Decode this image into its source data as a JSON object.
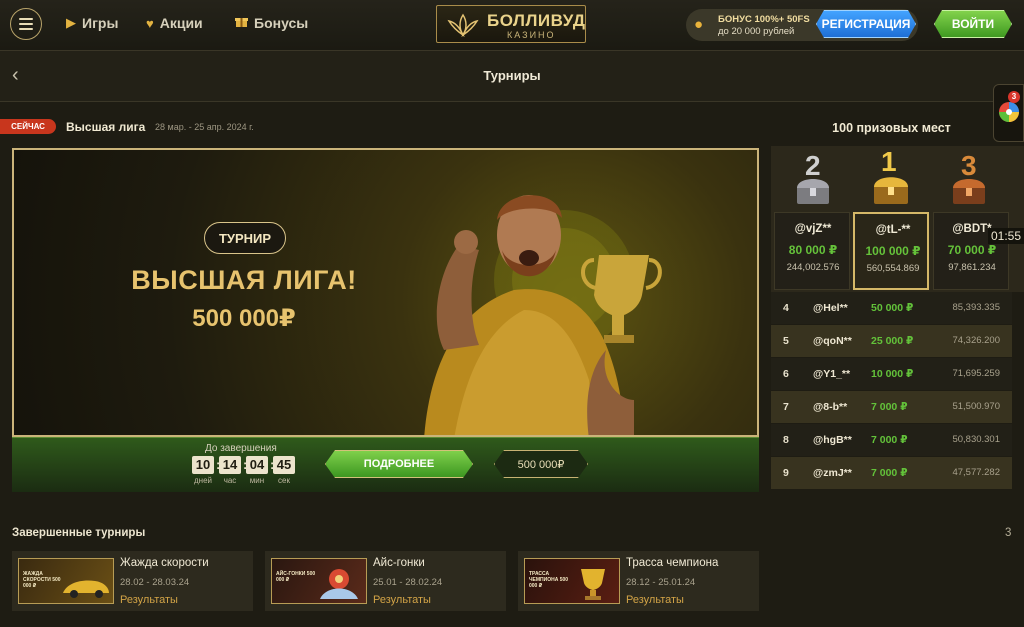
{
  "header": {
    "nav": [
      {
        "label": "Игры",
        "icon": "play-icon"
      },
      {
        "label": "Акции",
        "icon": "heart-icon"
      },
      {
        "label": "Бонусы",
        "icon": "gift-icon"
      }
    ],
    "logo_name": "БОЛЛИВУД",
    "logo_sub": "КАЗИНО",
    "bonus_line1": "БОНУС 100%+ 50FS",
    "bonus_line2": "до 20 000 рублей",
    "register_label": "РЕГИСТРАЦИЯ",
    "login_label": "ВОЙТИ"
  },
  "page": {
    "title": "Турниры"
  },
  "current": {
    "badge": "СЕЙЧАС",
    "name": "Высшая лига",
    "dates": "28 мар. - 25 апр. 2024 г.",
    "banner_pill": "ТУРНИР",
    "banner_title": "ВЫСШАЯ ЛИГА!",
    "banner_amount": "500 000₽",
    "countdown_label": "До завершения",
    "countdown": [
      {
        "value": "10",
        "unit": "дней"
      },
      {
        "value": "14",
        "unit": "час"
      },
      {
        "value": "04",
        "unit": "мин"
      },
      {
        "value": "45",
        "unit": "сек"
      }
    ],
    "more_label": "ПОДРОБНЕЕ",
    "prize_label": "500 000₽"
  },
  "leaderboard": {
    "title": "100 призовых мест",
    "podium": [
      {
        "place": "2",
        "name": "@vjZ**",
        "prize": "80 000 ₽",
        "points": "244,002.576"
      },
      {
        "place": "1",
        "name": "@tL-**",
        "prize": "100 000 ₽",
        "points": "560,554.869"
      },
      {
        "place": "3",
        "name": "@BDT*",
        "prize": "70 000 ₽",
        "points": "97,861.234"
      }
    ],
    "rows": [
      {
        "rank": "4",
        "name": "@Hel**",
        "prize": "50 000 ₽",
        "score": "85,393.335"
      },
      {
        "rank": "5",
        "name": "@qoN**",
        "prize": "25 000 ₽",
        "score": "74,326.200"
      },
      {
        "rank": "6",
        "name": "@Y1_**",
        "prize": "10 000 ₽",
        "score": "71,695.259"
      },
      {
        "rank": "7",
        "name": "@8-b**",
        "prize": "7 000 ₽",
        "score": "51,500.970"
      },
      {
        "rank": "8",
        "name": "@hgB**",
        "prize": "7 000 ₽",
        "score": "50,830.301"
      },
      {
        "rank": "9",
        "name": "@zmJ**",
        "prize": "7 000 ₽",
        "score": "47,577.282"
      }
    ],
    "timer_tip": "01:55",
    "wheel_badge": "3"
  },
  "finished": {
    "title": "Завершенные турниры",
    "count": "3",
    "items": [
      {
        "name": "Жажда скорости",
        "dates": "28.02 - 28.03.24",
        "results": "Результаты",
        "thumb_label": "ЖАЖДА СКОРОСТИ 500 000 ₽"
      },
      {
        "name": "Айс-гонки",
        "dates": "25.01 - 28.02.24",
        "results": "Результаты",
        "thumb_label": "АЙС-ГОНКИ 500 000 ₽"
      },
      {
        "name": "Трасса чемпиона",
        "dates": "28.12 - 25.01.24",
        "results": "Результаты",
        "thumb_label": "ТРАССА ЧЕМПИОНА 500 000 ₽"
      }
    ]
  },
  "colors": {
    "accent_gold": "#e7c36e",
    "prize_green": "#63c23a",
    "now_red": "#c8361d",
    "register_blue": "#2a84ea",
    "login_green": "#5fb535"
  }
}
